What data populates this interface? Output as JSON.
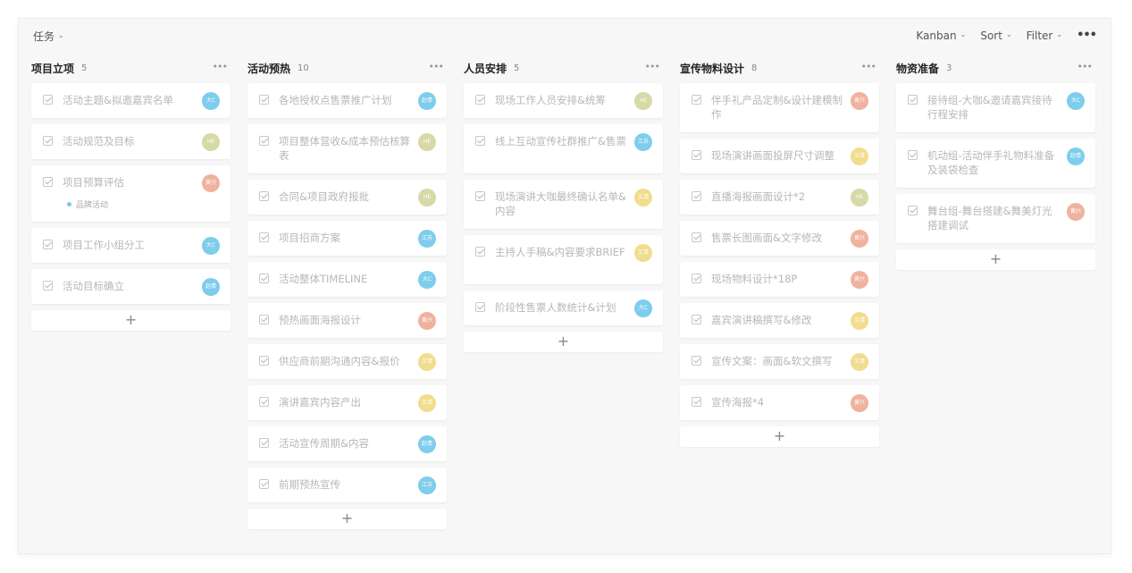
{
  "topbar": {
    "view_label": "任务",
    "kanban_label": "Kanban",
    "sort_label": "Sort",
    "filter_label": "Filter",
    "more_label": "•••"
  },
  "avatars": {
    "blue": {
      "color": "#7ecdec"
    },
    "olive": {
      "color": "#d7d9a6"
    },
    "salmon": {
      "color": "#f0b29f"
    },
    "yellow": {
      "color": "#f2dc8d"
    }
  },
  "columns": [
    {
      "title": "项目立项",
      "count": "5",
      "more": "•••",
      "cards": [
        {
          "text": "活动主题&拟邀嘉宾名单",
          "avatar": "大C",
          "avatar_color": "#7ecdec"
        },
        {
          "text": "活动规范及目标",
          "avatar": "HE",
          "avatar_color": "#d7d9a6"
        },
        {
          "text": "项目预算评估",
          "avatar": "黄兴",
          "avatar_color": "#f0b29f",
          "tag": "品牌活动"
        },
        {
          "text": "项目工作小组分工",
          "avatar": "大C",
          "avatar_color": "#7ecdec"
        },
        {
          "text": "活动目标确立",
          "avatar": "赵倩",
          "avatar_color": "#7ecdec"
        }
      ],
      "add": "+"
    },
    {
      "title": "活动预热",
      "count": "10",
      "more": "•••",
      "cards": [
        {
          "text": "各地授权点售票推广计划",
          "avatar": "赵倩",
          "avatar_color": "#7ecdec"
        },
        {
          "text": "项目整体营收&成本预估核算表",
          "avatar": "HE",
          "avatar_color": "#d7d9a6"
        },
        {
          "text": "合同&项目政府报批",
          "avatar": "HE",
          "avatar_color": "#d7d9a6"
        },
        {
          "text": "项目招商方案",
          "avatar": "江苏",
          "avatar_color": "#7ecdec"
        },
        {
          "text": "活动整体TIMELINE",
          "avatar": "大C",
          "avatar_color": "#7ecdec"
        },
        {
          "text": "预热画面海报设计",
          "avatar": "黄兴",
          "avatar_color": "#f0b29f"
        },
        {
          "text": "供应商前期沟通内容&报价",
          "avatar": "文清",
          "avatar_color": "#f2dc8d"
        },
        {
          "text": "演讲嘉宾内容产出",
          "avatar": "文清",
          "avatar_color": "#f2dc8d"
        },
        {
          "text": "活动宣传周期&内容",
          "avatar": "赵倩",
          "avatar_color": "#7ecdec"
        },
        {
          "text": "前期预热宣传",
          "avatar": "江苏",
          "avatar_color": "#7ecdec"
        }
      ],
      "add": "+"
    },
    {
      "title": "人员安排",
      "count": "5",
      "more": "•••",
      "cards": [
        {
          "text": "现场工作人员安排&统筹",
          "avatar": "HE",
          "avatar_color": "#d7d9a6"
        },
        {
          "text": "线上互动宣传社群推广&售票",
          "avatar": "江苏",
          "avatar_color": "#7ecdec"
        },
        {
          "text": "现场演讲大咖最终确认名单&内容",
          "avatar": "文清",
          "avatar_color": "#f2dc8d"
        },
        {
          "text": "主持人手稿&内容要求BRIEF",
          "avatar": "文清",
          "avatar_color": "#f2dc8d"
        },
        {
          "text": "阶段性售票人数统计&计划",
          "avatar": "大C",
          "avatar_color": "#7ecdec"
        }
      ],
      "add": "+"
    },
    {
      "title": "宣传物料设计",
      "count": "8",
      "more": "•••",
      "cards": [
        {
          "text": "伴手礼产品定制&设计建模制作",
          "avatar": "黄兴",
          "avatar_color": "#f0b29f"
        },
        {
          "text": "现场演讲画面投屏尺寸调整",
          "avatar": "文清",
          "avatar_color": "#f2dc8d"
        },
        {
          "text": "直播海报画面设计*2",
          "avatar": "HE",
          "avatar_color": "#d7d9a6"
        },
        {
          "text": "售票长图画面&文字修改",
          "avatar": "黄兴",
          "avatar_color": "#f0b29f"
        },
        {
          "text": "现场物料设计*18P",
          "avatar": "黄兴",
          "avatar_color": "#f0b29f"
        },
        {
          "text": "嘉宾演讲稿撰写&修改",
          "avatar": "文清",
          "avatar_color": "#f2dc8d"
        },
        {
          "text": "宣传文案：画面&软文撰写",
          "avatar": "文清",
          "avatar_color": "#f2dc8d"
        },
        {
          "text": "宣传海报*4",
          "avatar": "黄兴",
          "avatar_color": "#f0b29f"
        }
      ],
      "add": "+"
    },
    {
      "title": "物资准备",
      "count": "3",
      "more": "•••",
      "cards": [
        {
          "text": "接待组-大咖&邀请嘉宾接待行程安排",
          "avatar": "大C",
          "avatar_color": "#7ecdec"
        },
        {
          "text": "机动组-活动伴手礼物料准备及装袋检查",
          "avatar": "赵倩",
          "avatar_color": "#7ecdec"
        },
        {
          "text": "舞台组-舞台搭建&舞美灯光搭建调试",
          "avatar": "黄兴",
          "avatar_color": "#f0b29f"
        }
      ],
      "add": "+"
    }
  ]
}
